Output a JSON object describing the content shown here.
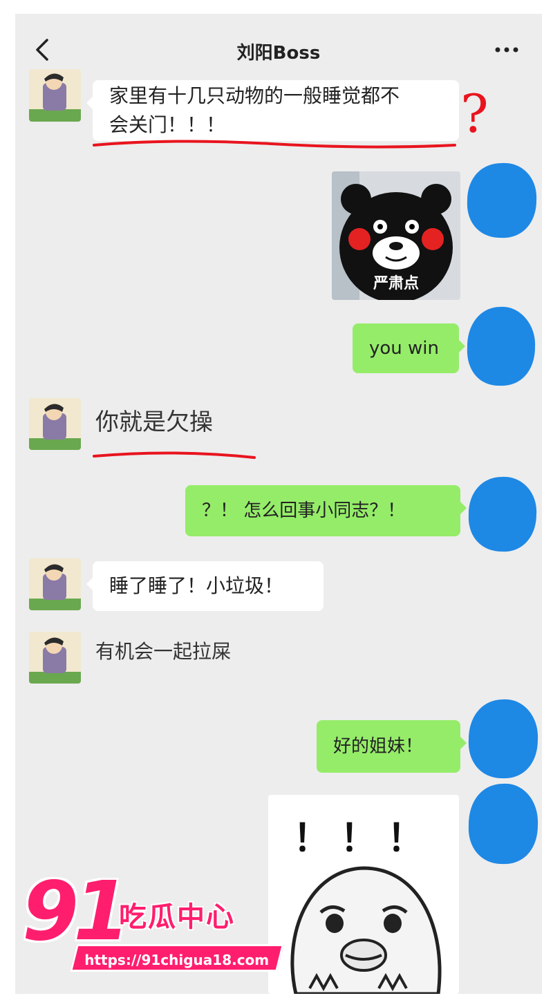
{
  "header": {
    "title": "刘阳Boss",
    "back_icon": "chevron-left-icon",
    "more_icon": "more-dots-icon"
  },
  "messages": [
    {
      "side": "left",
      "text": "家里有十几只动物的一般睡觉都不会关门！！！",
      "line1": "家里有十几只动物的一般睡觉都不",
      "line2": "会关门！！！"
    },
    {
      "side": "right",
      "type": "sticker",
      "caption": "严肃点"
    },
    {
      "side": "right",
      "text": "you win"
    },
    {
      "side": "left",
      "text": "你就是欠操"
    },
    {
      "side": "right",
      "text": "？！ 怎么回事小同志？！"
    },
    {
      "side": "left",
      "text": "睡了睡了！小垃圾！"
    },
    {
      "side": "left",
      "text": "有机会一起拉屎"
    },
    {
      "side": "right",
      "text": "好的姐妹！"
    },
    {
      "side": "right",
      "type": "sticker",
      "caption": "！！！"
    }
  ],
  "annotations": {
    "question_mark": "?"
  },
  "watermark": {
    "number": "91",
    "name": "吃瓜中心",
    "url": "https://91chigua18.com"
  },
  "colors": {
    "background": "#ededed",
    "bubble_self": "#95ec69",
    "bubble_other": "#ffffff",
    "mask_blob": "#1e88e5",
    "underline": "#e8141e",
    "watermark": "#ff1e6e"
  }
}
